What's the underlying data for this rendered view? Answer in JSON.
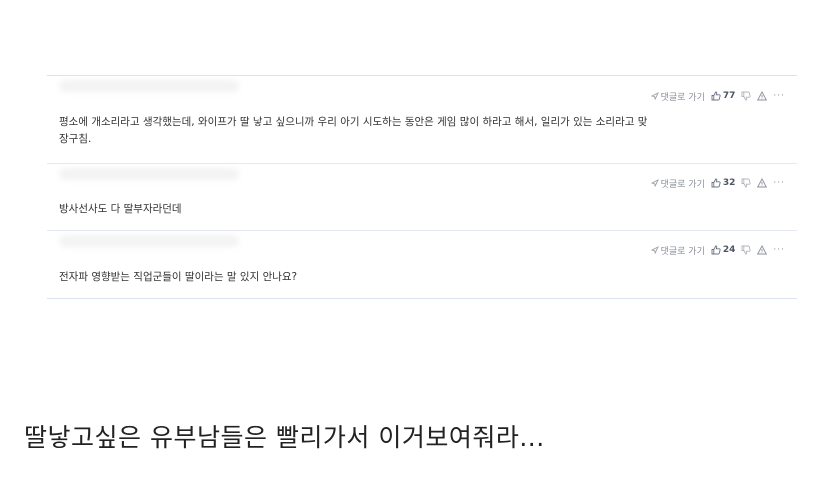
{
  "comments": [
    {
      "reply_label": "댓글로 가기",
      "likes": "77",
      "lines": [
        "평소에 개소리라고 생각했는데, 와이프가 딸 낳고 싶으니까 우리 아기 시도하는 동안은 게임 많이 하라고 해서, 일리가 있는 소리라고 맞",
        "장구침."
      ]
    },
    {
      "reply_label": "댓글로 가기",
      "likes": "32",
      "lines": [
        "방사선사도 다 딸부자라던데"
      ]
    },
    {
      "reply_label": "댓글로 가기",
      "likes": "24",
      "lines": [
        "전자파 영향받는 직업군들이 딸이라는 말 있지 안나요?"
      ]
    }
  ],
  "caption": "딸낳고싶은 유부남들은 빨리가서 이거보여줘라..."
}
